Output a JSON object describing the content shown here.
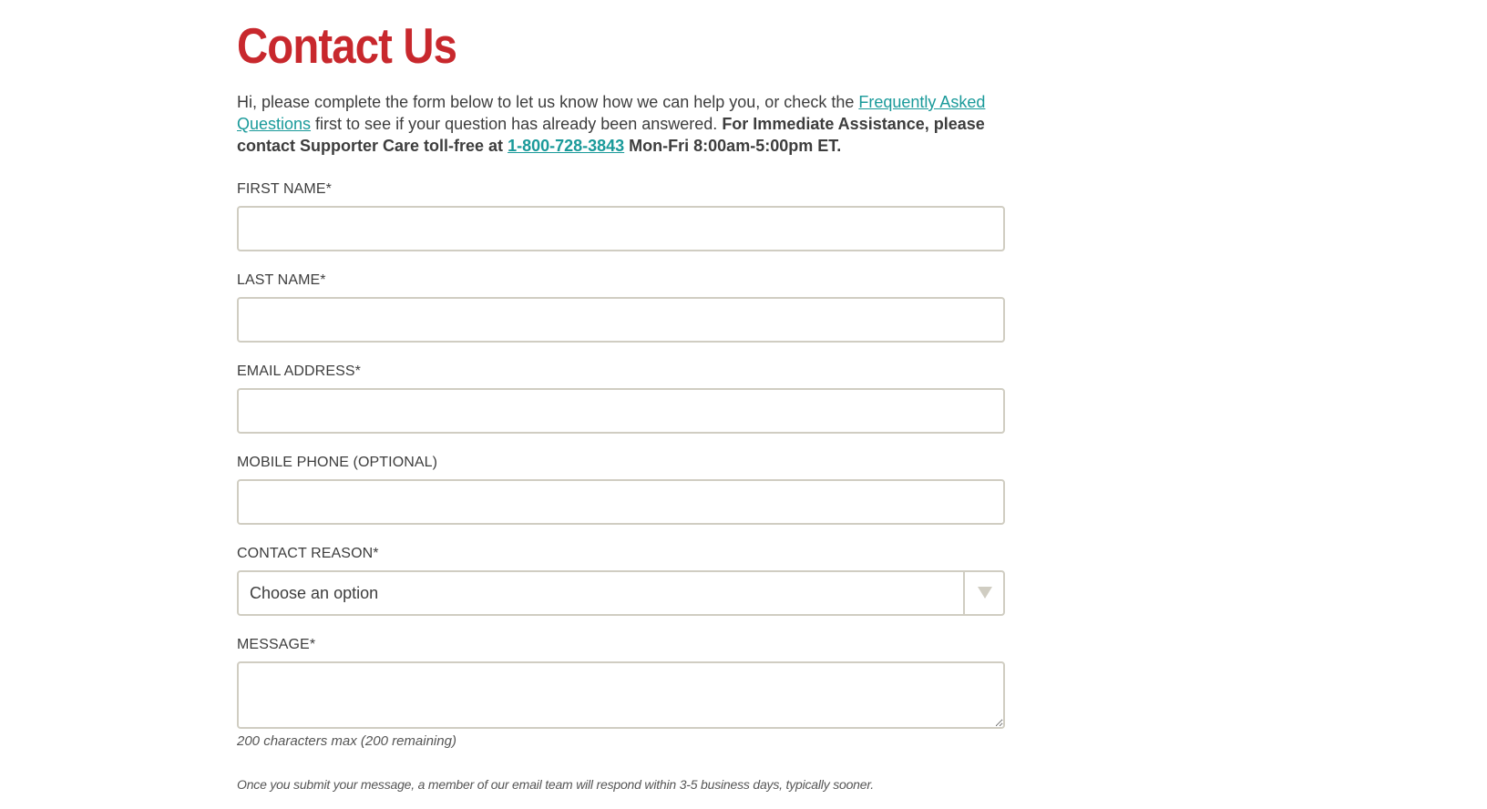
{
  "page": {
    "title": "Contact Us"
  },
  "intro": {
    "text_1": "Hi, please complete the form below to let us know how we can help you, or check the ",
    "faq_link": "Frequently Asked Questions",
    "text_2": " first to see if your question has already been answered. ",
    "bold_1": "For Immediate Assistance, please contact Supporter Care toll-free at ",
    "phone_link": "1-800-728-3843",
    "bold_2": " Mon-Fri 8:00am-5:00pm ET."
  },
  "form": {
    "first_name": {
      "label": "FIRST NAME*",
      "value": "",
      "placeholder": ""
    },
    "last_name": {
      "label": "LAST NAME*",
      "value": "",
      "placeholder": ""
    },
    "email": {
      "label": "EMAIL ADDRESS*",
      "value": "",
      "placeholder": ""
    },
    "mobile_phone": {
      "label": "MOBILE PHONE (OPTIONAL)",
      "value": "",
      "placeholder": ""
    },
    "contact_reason": {
      "label": "CONTACT REASON*",
      "selected": "Choose an option"
    },
    "message": {
      "label": "MESSAGE*",
      "value": "",
      "char_count": "200 characters max (200 remaining)"
    }
  },
  "footer_note": "Once you submit your message, a member of our email team will respond within 3-5 business days, typically sooner.",
  "colors": {
    "title_red": "#c8282d",
    "link_teal": "#1a9a9a",
    "input_border": "#d0cdc2"
  }
}
